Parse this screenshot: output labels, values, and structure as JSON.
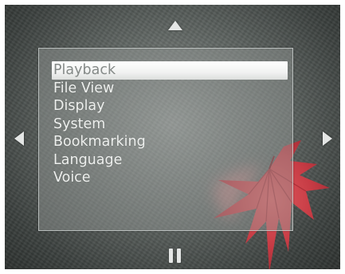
{
  "menu": {
    "items": [
      {
        "label": "Playback",
        "selected": true
      },
      {
        "label": "File View",
        "selected": false
      },
      {
        "label": "Display",
        "selected": false
      },
      {
        "label": "System",
        "selected": false
      },
      {
        "label": "Bookmarking",
        "selected": false
      },
      {
        "label": "Language",
        "selected": false
      },
      {
        "label": "Voice",
        "selected": false
      }
    ]
  },
  "controls": {
    "up": "up-arrow-icon",
    "down": "pause-icon",
    "left": "left-arrow-icon",
    "right": "right-arrow-icon"
  },
  "colors": {
    "highlight": "#ffffff",
    "highlight_text": "#858a88",
    "menu_text": "#eef0ee",
    "panel_border": "#d2d7d5",
    "leaf": "#d94a4f"
  }
}
